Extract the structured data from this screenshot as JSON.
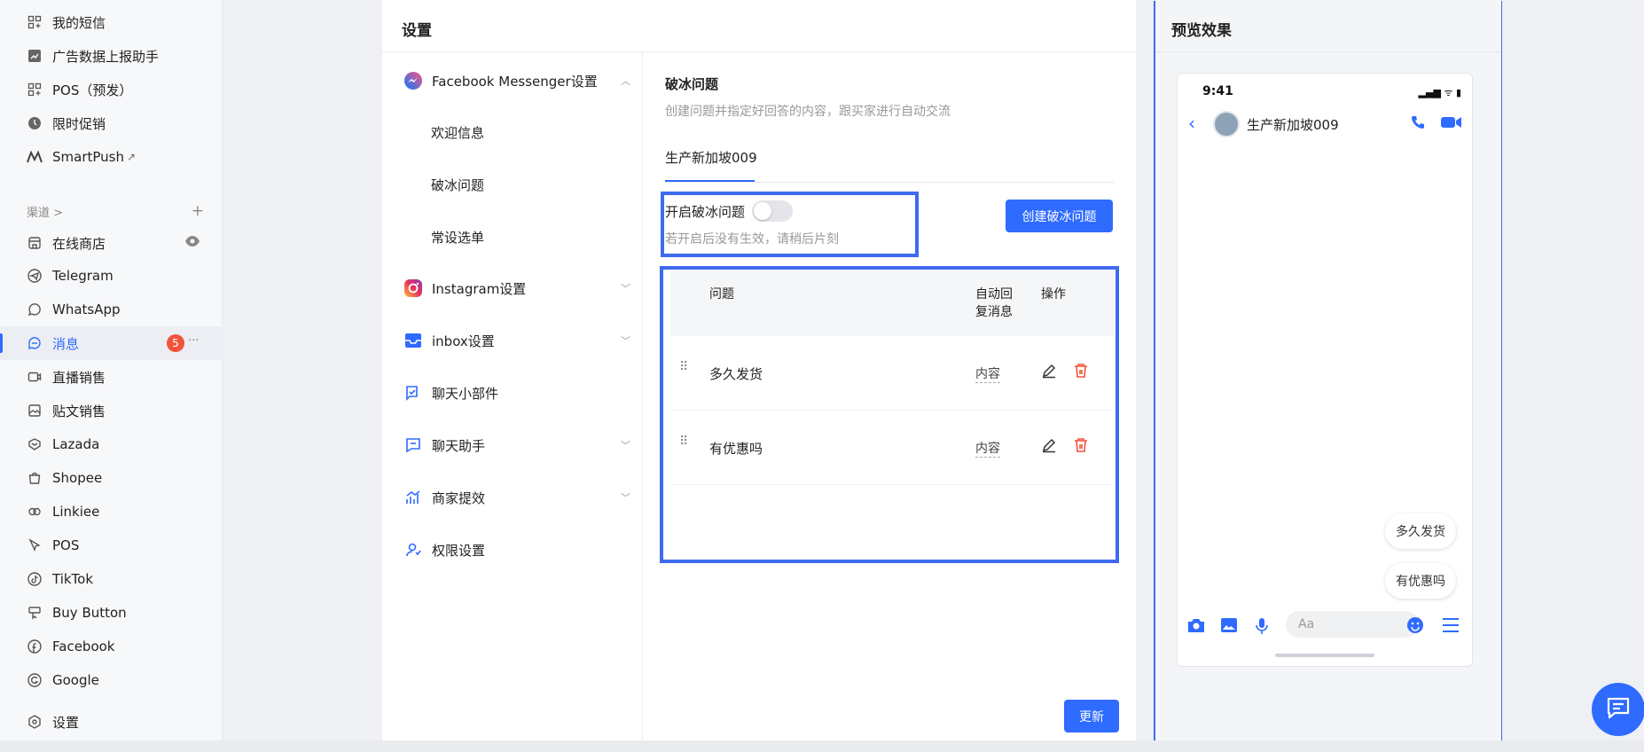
{
  "nav": {
    "items_top": [
      {
        "label": "我的短信",
        "icon": "grid-icon"
      },
      {
        "label": "广告数据上报助手",
        "icon": "chart-icon"
      },
      {
        "label": "POS（预发）",
        "icon": "grid-icon"
      },
      {
        "label": "限时促销",
        "icon": "timer-icon"
      },
      {
        "label": "SmartPush",
        "icon": "smartpush-icon"
      }
    ],
    "section_label": "渠道 >",
    "section_add": "+",
    "channels": [
      {
        "label": "在线商店",
        "icon": "store-icon"
      },
      {
        "label": "Telegram",
        "icon": "telegram-icon"
      },
      {
        "label": "WhatsApp",
        "icon": "whatsapp-icon"
      },
      {
        "label": "消息",
        "icon": "message-icon",
        "badge": "5",
        "more": "···"
      },
      {
        "label": "直播销售",
        "icon": "live-icon"
      },
      {
        "label": "贴文销售",
        "icon": "post-icon"
      },
      {
        "label": "Lazada",
        "icon": "lazada-icon"
      },
      {
        "label": "Shopee",
        "icon": "shopee-icon"
      },
      {
        "label": "Linkiee",
        "icon": "link-icon"
      },
      {
        "label": "POS",
        "icon": "pos-icon"
      },
      {
        "label": "TikTok",
        "icon": "tiktok-icon"
      },
      {
        "label": "Buy Button",
        "icon": "buybutton-icon"
      },
      {
        "label": "Facebook",
        "icon": "facebook-icon"
      },
      {
        "label": "Google",
        "icon": "google-icon"
      }
    ],
    "settings_label": "设置"
  },
  "settings": {
    "title": "设置",
    "menu": {
      "messenger": "Facebook Messenger设置",
      "subitems": [
        "欢迎信息",
        "破冰问题",
        "常设选单"
      ],
      "instagram": "Instagram设置",
      "inbox": "inbox设置",
      "widget": "聊天小部件",
      "assistant": "聊天助手",
      "merchant": "商家提效",
      "permission": "权限设置"
    },
    "content": {
      "title": "破冰问题",
      "description": "创建问题并指定好回答的内容，跟买家进行自动交流",
      "tab": "生产新加坡009",
      "toggle_label": "开启破冰问题",
      "toggle_on": false,
      "hint": "若开启后没有生效，请稍后片刻",
      "create_button": "创建破冰问题",
      "table": {
        "col_question": "问题",
        "col_auto_reply_1": "自动回",
        "col_auto_reply_2": "复消息",
        "col_action": "操作",
        "rows": [
          {
            "question": "多久发货",
            "answer": "内容"
          },
          {
            "question": "有优惠吗",
            "answer": "内容"
          }
        ]
      },
      "update_button": "更新"
    }
  },
  "preview": {
    "title": "预览效果",
    "time": "9:41",
    "status_icons": "▂▄▆ ᯤ ▮",
    "contact_name": "生产新加坡009",
    "bubbles": [
      "多久发货",
      "有优惠吗"
    ],
    "input_placeholder": "Aa"
  },
  "colors": {
    "accent": "#2f6bff",
    "highlight_border": "#3e6af0",
    "danger": "#f0543a"
  }
}
